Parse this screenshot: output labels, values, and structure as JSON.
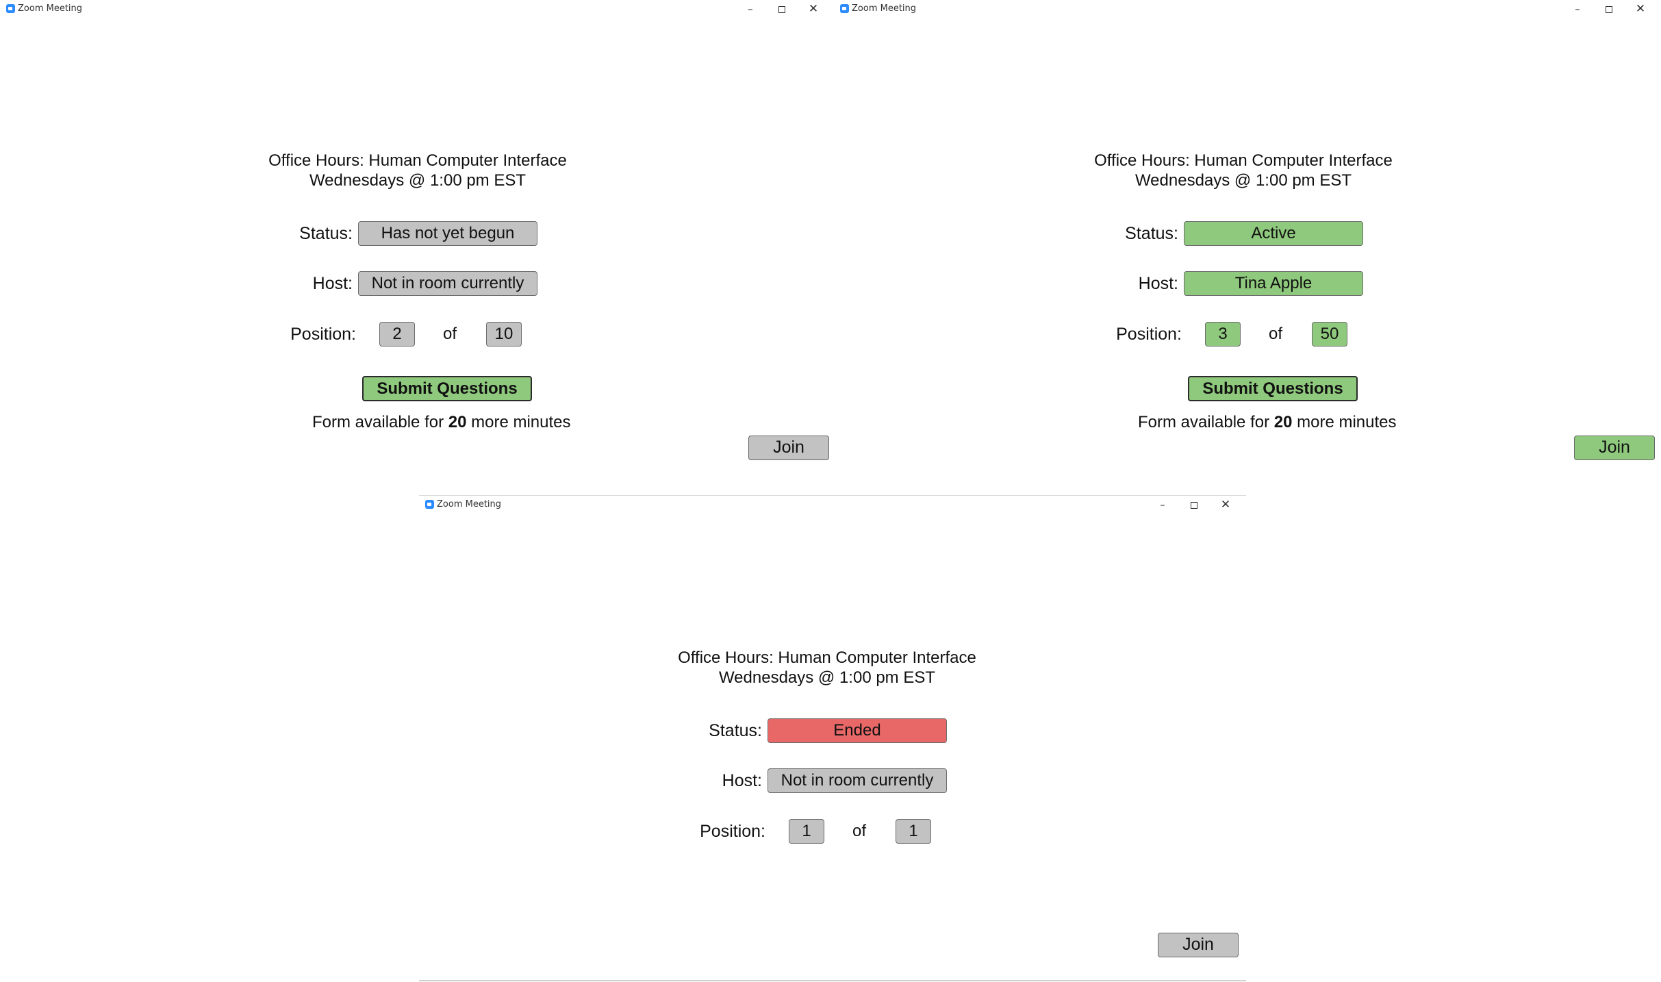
{
  "windows": [
    {
      "title": "Zoom Meeting",
      "window_controls": {
        "minimize": "–",
        "maximize": "□",
        "close": "✕"
      },
      "course_title": "Office Hours: Human Computer Interface",
      "schedule": "Wednesdays @ 1:00 pm EST",
      "status_label": "Status:",
      "status_value": "Has not yet begun",
      "status_color": "#c2c2c2",
      "host_label": "Host:",
      "host_value": "Not in room currently",
      "host_color": "#c2c2c2",
      "position_label": "Position:",
      "position_current": "2",
      "position_of": "of",
      "position_total": "10",
      "position_color": "#c2c2c2",
      "submit_label": "Submit Questions",
      "form_note_prefix": "Form available for",
      "form_note_minutes": "20",
      "form_note_suffix": "more minutes",
      "join_label": "Join",
      "join_color": "#c2c2c2"
    },
    {
      "title": "Zoom Meeting",
      "window_controls": {
        "minimize": "–",
        "maximize": "□",
        "close": "✕"
      },
      "course_title": "Office Hours: Human Computer Interface",
      "schedule": "Wednesdays @ 1:00 pm EST",
      "status_label": "Status:",
      "status_value": "Active",
      "status_color": "#8fc97d",
      "host_label": "Host:",
      "host_value": "Tina Apple",
      "host_color": "#8fc97d",
      "position_label": "Position:",
      "position_current": "3",
      "position_of": "of",
      "position_total": "50",
      "position_color": "#8fc97d",
      "submit_label": "Submit Questions",
      "form_note_prefix": "Form available for",
      "form_note_minutes": "20",
      "form_note_suffix": "more minutes",
      "join_label": "Join",
      "join_color": "#8fc97d"
    },
    {
      "title": "Zoom Meeting",
      "window_controls": {
        "minimize": "–",
        "maximize": "□",
        "close": "✕"
      },
      "course_title": "Office Hours: Human Computer Interface",
      "schedule": "Wednesdays @ 1:00 pm EST",
      "status_label": "Status:",
      "status_value": "Ended",
      "status_color": "#e86868",
      "host_label": "Host:",
      "host_value": "Not in room currently",
      "host_color": "#c2c2c2",
      "position_label": "Position:",
      "position_current": "1",
      "position_of": "of",
      "position_total": "1",
      "position_color": "#c2c2c2",
      "join_label": "Join",
      "join_color": "#c2c2c2"
    }
  ]
}
